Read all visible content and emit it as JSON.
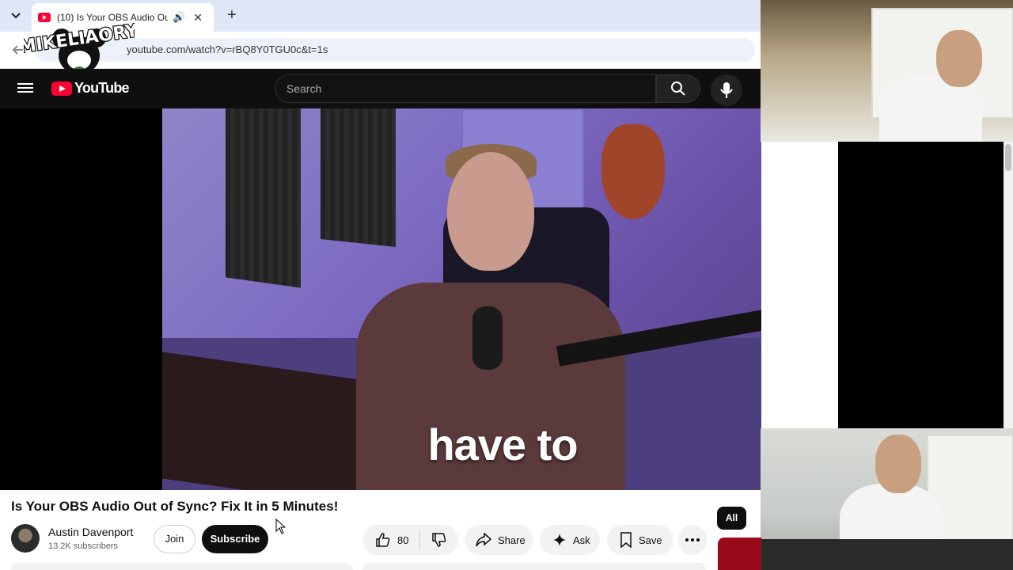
{
  "browser": {
    "tab_title": "(10) Is Your OBS Audio Out of Sync? Fix It in 5 Minutes!",
    "url": "youtube.com/watch?v=rBQ8Y0TGU0c&t=1s"
  },
  "watermark": {
    "text": "MIKELIAORY"
  },
  "youtube": {
    "logo_text": "YouTube",
    "search_placeholder": "Search"
  },
  "player": {
    "caption": "have to"
  },
  "video": {
    "title": "Is Your OBS Audio Out of Sync? Fix It in 5 Minutes!",
    "channel": "Austin Davenport",
    "subscribers": "13.2K subscribers",
    "join_label": "Join",
    "subscribe_label": "Subscribe",
    "like_count": "80",
    "share_label": "Share",
    "ask_label": "Ask",
    "save_label": "Save"
  },
  "chips": {
    "all_label": "All"
  },
  "colors": {
    "yt_red": "#ff0033",
    "header_bg": "#0f0f0f",
    "pill_bg": "#f2f2f2"
  }
}
